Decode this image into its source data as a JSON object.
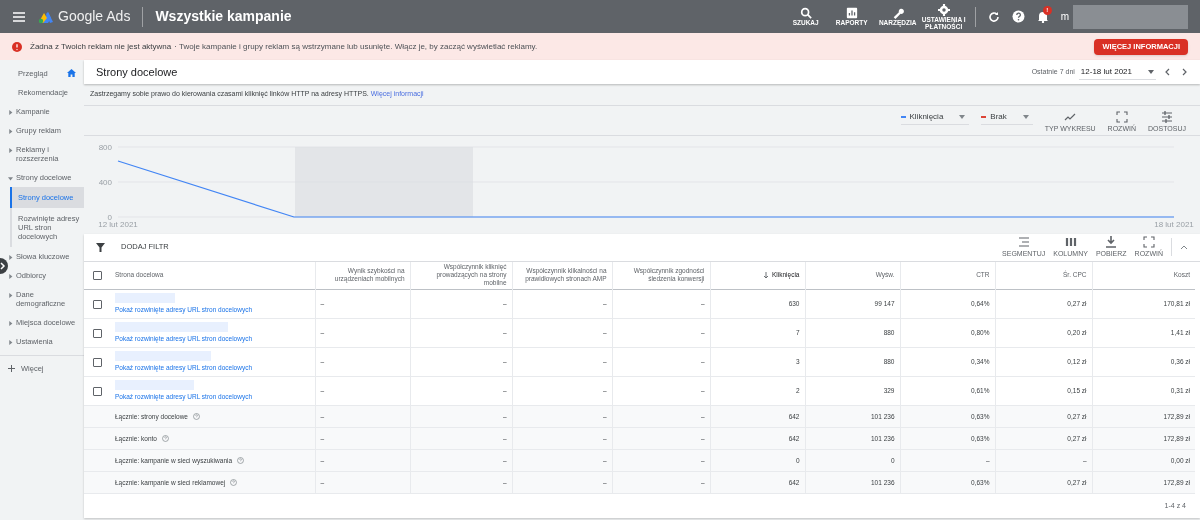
{
  "header": {
    "product": "Google Ads",
    "title": "Wszystkie kampanie",
    "tools": [
      {
        "kind": "search",
        "label": "SZUKAJ"
      },
      {
        "kind": "reports",
        "label": "RAPORTY"
      },
      {
        "kind": "tools",
        "label": "NARZĘDZIA"
      },
      {
        "kind": "settings",
        "label": "USTAWIENIA I PŁATNOŚCI"
      }
    ],
    "notifications_badge": "!",
    "account_initial": "m"
  },
  "banner": {
    "title": "Żadna z Twoich reklam nie jest aktywna",
    "message": "· Twoje kampanie i grupy reklam są wstrzymane lub usunięte. Włącz je, by zacząć wyświetlać reklamy.",
    "button": "WIĘCEJ INFORMACJI"
  },
  "sidebar": {
    "items": [
      {
        "label": "Przegląd",
        "kind": "home",
        "selected": false
      },
      {
        "label": "Rekomendacje",
        "kind": "plain",
        "selected": false
      },
      {
        "label": "Kampanie",
        "kind": "group",
        "expanded": false,
        "selected": false
      },
      {
        "label": "Grupy reklam",
        "kind": "group",
        "expanded": false,
        "selected": false
      },
      {
        "label": "Reklamy i rozszerzenia",
        "kind": "group",
        "expanded": false,
        "selected": false
      },
      {
        "label": "Strony docelowe",
        "kind": "group",
        "expanded": true,
        "selected": false,
        "children": [
          {
            "label": "Strony docelowe",
            "selected": true
          },
          {
            "label": "Rozwinięte adresy URL stron docelowych",
            "selected": false
          }
        ]
      },
      {
        "label": "Słowa kluczowe",
        "kind": "group",
        "expanded": false,
        "selected": false
      },
      {
        "label": "Odbiorcy",
        "kind": "group",
        "expanded": false,
        "selected": false
      },
      {
        "label": "Dane demograficzne",
        "kind": "group",
        "expanded": false,
        "selected": false
      },
      {
        "label": "Miejsca docelowe",
        "kind": "group",
        "expanded": false,
        "selected": false
      },
      {
        "label": "Ustawienia",
        "kind": "group",
        "expanded": false,
        "selected": false
      },
      {
        "label": "Więcej",
        "kind": "more",
        "selected": false
      }
    ]
  },
  "page": {
    "title": "Strony docelowe",
    "date_range_label": "Ostatnie 7 dni",
    "date_range": "12-18 lut 2021",
    "notice": "Zastrzegamy sobie prawo do kierowania czasami kliknięć linków HTTP na adresy HTTPS.",
    "notice_link": "Więcej informacji"
  },
  "chart": {
    "metrics": [
      {
        "label": "Kliknięcia",
        "color": "#4285f4"
      },
      {
        "label": "Brak",
        "color": "#db4437"
      }
    ],
    "tools": [
      {
        "kind": "chart_type",
        "label": "TYP WYKRESU"
      },
      {
        "kind": "expand",
        "label": "ROZWIŃ"
      },
      {
        "kind": "adjust",
        "label": "DOSTOSUJ"
      }
    ],
    "chart_data": {
      "type": "line",
      "categories": [
        "12 lut 2021",
        null,
        null,
        null,
        null,
        null,
        "18 lut 2021"
      ],
      "yticks": [
        0,
        400,
        800
      ],
      "ylim": [
        0,
        800
      ],
      "series": [
        {
          "color": "#4285f4",
          "values": [
            640,
            0,
            0,
            0,
            0,
            0,
            0
          ]
        }
      ]
    }
  },
  "table": {
    "filter": "DODAJ FILTR",
    "tools": [
      {
        "kind": "segment",
        "label": "SEGMENTUJ"
      },
      {
        "kind": "columns",
        "label": "KOLUMNY"
      },
      {
        "kind": "download",
        "label": "POBIERZ"
      },
      {
        "kind": "expand",
        "label": "ROZWIŃ"
      }
    ],
    "columns": [
      {
        "label": "Strona docelowa",
        "sorted": false
      },
      {
        "label": "Wynik szybkości na urządzeniach mobilnych",
        "sorted": false
      },
      {
        "label": "Współczynnik kliknięć prowadzących na strony mobilne",
        "sorted": false
      },
      {
        "label": "Współczynnik klikalności na prawidłowych stronach AMP",
        "sorted": false
      },
      {
        "label": "Współczynnik zgodności śledzenia konwersji",
        "sorted": false
      },
      {
        "label": "Kliknięcia",
        "sorted": true
      },
      {
        "label": "Wyśw.",
        "sorted": false
      },
      {
        "label": "CTR",
        "sorted": false
      },
      {
        "label": "Śr. CPC",
        "sorted": false
      },
      {
        "label": "Koszt",
        "sorted": false
      }
    ],
    "select_all_checked": false,
    "rows": [
      {
        "kind": "page",
        "checked": false,
        "cells": [
          "Pokaż rozwinięte adresy URL stron docelowych",
          "–",
          "–",
          "–",
          "–",
          "630",
          "99 147",
          "0,64%",
          "0,27 zł",
          "170,81 zł"
        ]
      },
      {
        "kind": "page",
        "checked": false,
        "cells": [
          "Pokaż rozwinięte adresy URL stron docelowych",
          "–",
          "–",
          "–",
          "–",
          "7",
          "880",
          "0,80%",
          "0,20 zł",
          "1,41 zł"
        ]
      },
      {
        "kind": "page",
        "checked": false,
        "cells": [
          "Pokaż rozwinięte adresy URL stron docelowych",
          "–",
          "–",
          "–",
          "–",
          "3",
          "880",
          "0,34%",
          "0,12 zł",
          "0,36 zł"
        ]
      },
      {
        "kind": "page",
        "checked": false,
        "cells": [
          "Pokaż rozwinięte adresy URL stron docelowych",
          "–",
          "–",
          "–",
          "–",
          "2",
          "329",
          "0,61%",
          "0,15 zł",
          "0,31 zł"
        ]
      },
      {
        "kind": "total",
        "cells": [
          "Łącznie: strony docelowe",
          "–",
          "–",
          "–",
          "–",
          "642",
          "101 236",
          "0,63%",
          "0,27 zł",
          "172,89 zł"
        ]
      },
      {
        "kind": "total",
        "cells": [
          "Łącznie: konto",
          "–",
          "–",
          "–",
          "–",
          "642",
          "101 236",
          "0,63%",
          "0,27 zł",
          "172,89 zł"
        ]
      },
      {
        "kind": "total",
        "cells": [
          "Łącznie: kampanie w sieci wyszukiwania",
          "–",
          "–",
          "–",
          "–",
          "0",
          "0",
          "–",
          "–",
          "0,00 zł"
        ]
      },
      {
        "kind": "total",
        "cells": [
          "Łącznie: kampanie w sieci reklamowej",
          "–",
          "–",
          "–",
          "–",
          "642",
          "101 236",
          "0,63%",
          "0,27 zł",
          "172,89 zł"
        ]
      }
    ],
    "pagination": "1-4 z 4"
  }
}
